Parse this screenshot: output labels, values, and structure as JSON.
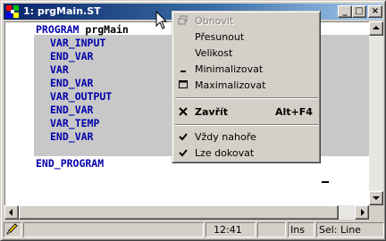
{
  "window": {
    "title": "1: prgMain.ST",
    "title_color": "#0a246a",
    "app_icon": "multi-color-grid-icon",
    "buttons": {
      "minimize": "_",
      "maximize": "□",
      "close": "×"
    }
  },
  "editor": {
    "lines": [
      {
        "keyword": "PROGRAM",
        "ident": " prgMain"
      },
      {
        "keyword": "VAR_INPUT"
      },
      {
        "keyword": "END_VAR"
      },
      {
        "keyword": "VAR"
      },
      {
        "keyword": "END_VAR"
      },
      {
        "keyword": "VAR_OUTPUT"
      },
      {
        "keyword": "END_VAR"
      },
      {
        "keyword": "VAR_TEMP"
      },
      {
        "keyword": "END_VAR"
      },
      {
        "keyword": ""
      },
      {
        "keyword": "END_PROGRAM"
      }
    ],
    "keyword_color": "#0000aa",
    "selection_color": "#c8c8c8"
  },
  "system_menu": {
    "items": [
      {
        "label": "Obnovit",
        "icon": "restore-icon",
        "disabled": true
      },
      {
        "label": "Přesunout"
      },
      {
        "label": "Velikost"
      },
      {
        "label": "Minimalizovat",
        "icon": "minimize-icon"
      },
      {
        "label": "Maximalizovat",
        "icon": "maximize-icon"
      },
      {
        "label": "Zavřít",
        "shortcut": "Alt+F4",
        "icon": "close-icon",
        "bold": true
      },
      {
        "label": "Vždy nahoře",
        "icon": "checkmark-icon",
        "checked": true
      },
      {
        "label": "Lze dokovat",
        "icon": "checkmark-icon",
        "checked": true
      }
    ]
  },
  "statusbar": {
    "message": "",
    "time": "12:41",
    "blank": "",
    "ins": "Ins",
    "sel": "Sel: Line"
  }
}
